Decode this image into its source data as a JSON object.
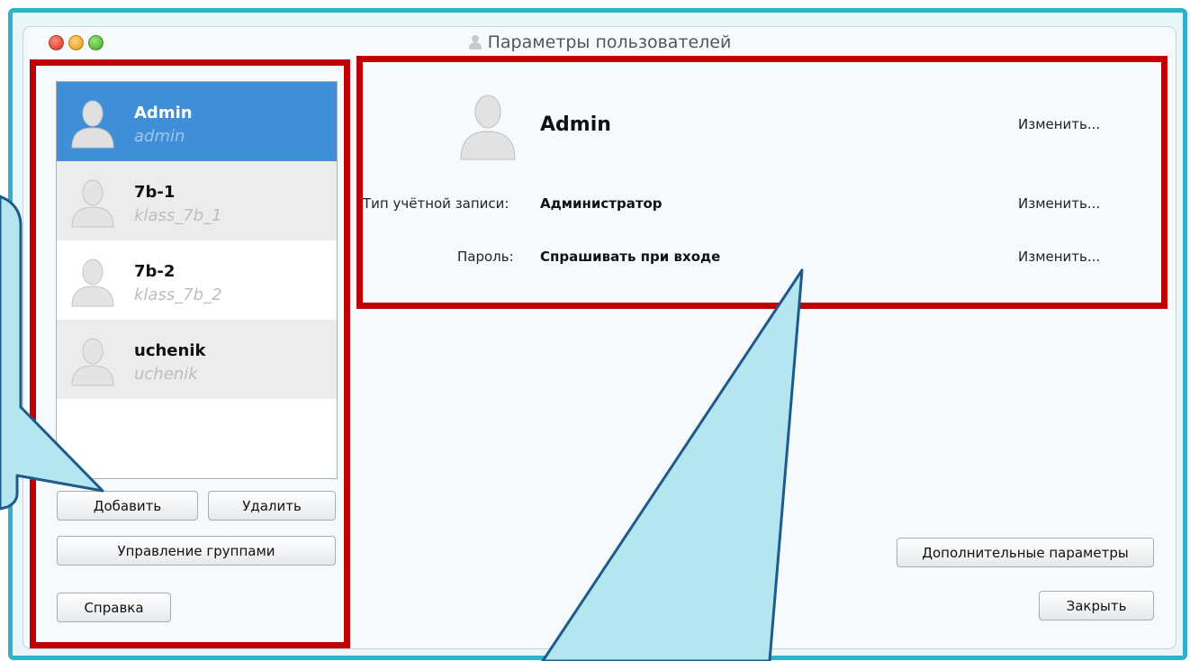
{
  "window": {
    "title": "Параметры пользователей"
  },
  "users": [
    {
      "name": "Admin",
      "login": "admin"
    },
    {
      "name": "7b-1",
      "login": "klass_7b_1"
    },
    {
      "name": "7b-2",
      "login": "klass_7b_2"
    },
    {
      "name": "uchenik",
      "login": "uchenik"
    }
  ],
  "buttons": {
    "add": "Добавить",
    "remove": "Удалить",
    "manage_groups": "Управление группами",
    "help": "Справка",
    "advanced": "Дополнительные параметры",
    "close": "Закрыть"
  },
  "details": {
    "name": "Admin",
    "change_label": "Изменить...",
    "account_type_label": "Тип учётной записи:",
    "account_type_value": "Администратор",
    "password_label": "Пароль:",
    "password_value": "Спрашивать при входе"
  },
  "colors": {
    "selection": "#3f8fd8",
    "highlight_border": "#c00000",
    "callout_fill": "#b5e6f0",
    "callout_border": "#1d5a8e"
  }
}
